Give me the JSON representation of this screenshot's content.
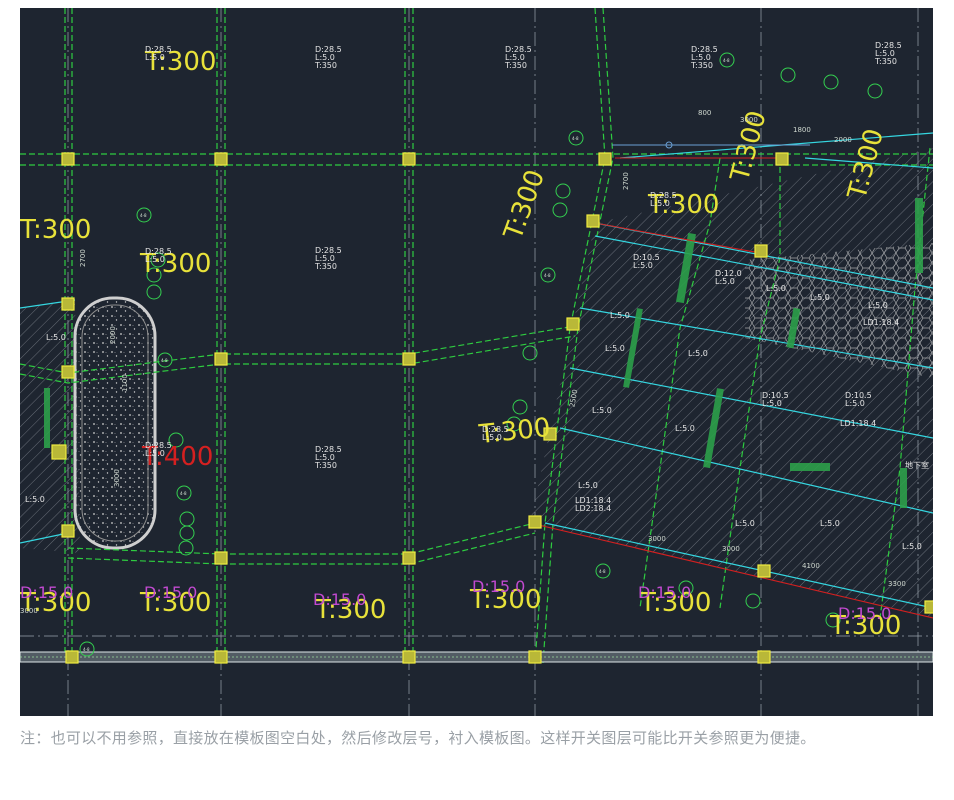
{
  "drawing": {
    "elevations": {
      "main": "T:300",
      "red": "T:400",
      "mag": "D:15.0"
    },
    "slab_block": [
      "D:28.5",
      "L:5.0",
      "T:350"
    ],
    "slab_block_b": [
      "D:10.5",
      "L:5.0"
    ],
    "slab_block_c": [
      "D:12.0",
      "L:5.0"
    ],
    "label_L5": "L:5.0",
    "label_LD18": "LD1:18.4",
    "label_LD2": "LD2:18.4",
    "label_sd": "地下室",
    "dims": [
      "3000",
      "1800",
      "2000",
      "800",
      "2700",
      "2500",
      "3000",
      "3000",
      "4100",
      "3300",
      "2500",
      "1100",
      "3000",
      "2000",
      "3300"
    ],
    "axis_tag": "4-8"
  },
  "caption": {
    "text": "注：也可以不用参照，直接放在模板图空白处，然后修改层号，衬入模板图。这样开关图层可能比开关参照更为便捷。"
  }
}
